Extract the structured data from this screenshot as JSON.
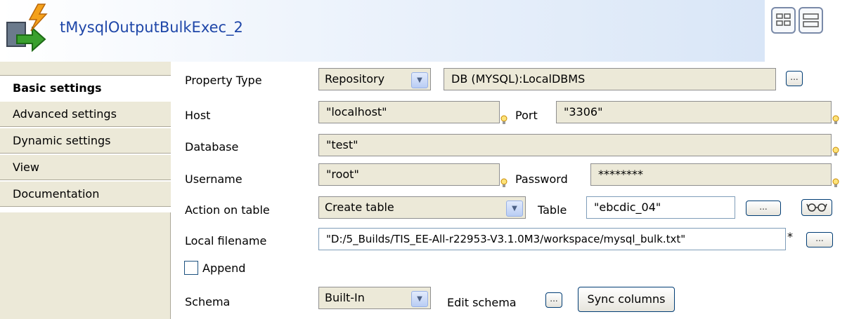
{
  "header": {
    "title": "tMysqlOutputBulkExec_2"
  },
  "sidebar": {
    "tabs": [
      {
        "label": "Basic settings"
      },
      {
        "label": "Advanced settings"
      },
      {
        "label": "Dynamic settings"
      },
      {
        "label": "View"
      },
      {
        "label": "Documentation"
      }
    ],
    "active_tab": "Basic settings"
  },
  "form": {
    "property_type": {
      "label": "Property Type",
      "value": "Repository",
      "repository": "DB (MYSQL):LocalDBMS"
    },
    "host": {
      "label": "Host",
      "value": "\"localhost\""
    },
    "port": {
      "label": "Port",
      "value": "\"3306\""
    },
    "database": {
      "label": "Database",
      "value": "\"test\""
    },
    "username": {
      "label": "Username",
      "value": "\"root\""
    },
    "password": {
      "label": "Password",
      "value": "********"
    },
    "action_on_table": {
      "label": "Action on table",
      "value": "Create table"
    },
    "table": {
      "label": "Table",
      "value": "\"ebcdic_04\""
    },
    "local_filename": {
      "label": "Local filename",
      "value": "\"D:/5_Builds/TIS_EE-All-r22953-V3.1.0M3/workspace/mysql_bulk.txt\"",
      "modified_marker": "*"
    },
    "append": {
      "label": "Append",
      "checked": false
    },
    "schema": {
      "label": "Schema",
      "value": "Built-In",
      "edit_label": "Edit schema",
      "sync_label": "Sync columns"
    },
    "dots": "..."
  },
  "colors": {
    "title": "#1e46a8",
    "field_bg": "#ece9d8",
    "sidebar_bg": "#ece9d8"
  }
}
